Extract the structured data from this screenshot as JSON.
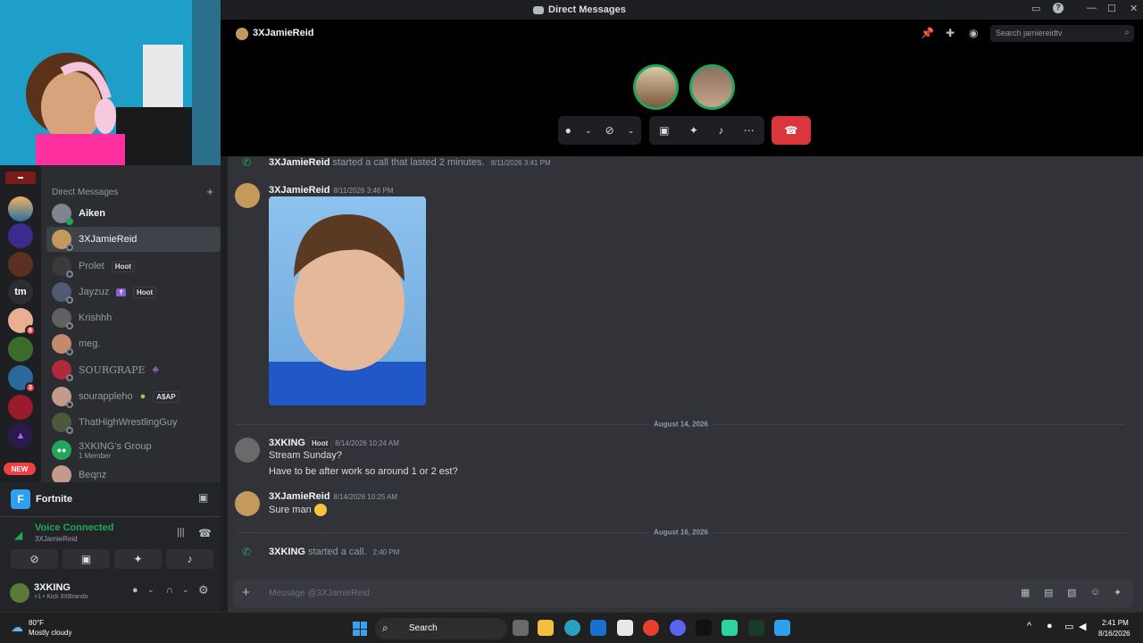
{
  "window": {
    "title": "Direct Messages"
  },
  "header": {
    "username": "3XJamieReid",
    "search_placeholder": "Search jamiereidtv"
  },
  "dm_list": {
    "heading": "Direct Messages",
    "items": [
      {
        "name": "Aiken",
        "tag": ""
      },
      {
        "name": "3XJamieReid",
        "tag": ""
      },
      {
        "name": "Prolet",
        "tag": "Hoot"
      },
      {
        "name": "Jayzuz",
        "tag": "Hoot"
      },
      {
        "name": "Krishhh",
        "tag": ""
      },
      {
        "name": "meg.",
        "tag": ""
      },
      {
        "name": "SOURGRAPE",
        "tag": ""
      },
      {
        "name": "sourappleho",
        "tag": "A$AP"
      },
      {
        "name": "ThatHighWrestlingGuy",
        "tag": ""
      },
      {
        "name": "3XKING's Group",
        "sub": "1 Member"
      },
      {
        "name": "Beqnz",
        "tag": ""
      }
    ]
  },
  "servers": {
    "new_badge": "NEW",
    "tm_label": "tm",
    "badge_1": "8",
    "badge_2": "3"
  },
  "activity": {
    "game": "Fortnite",
    "voice_status": "Voice Connected",
    "voice_channel": "3XJamieReid"
  },
  "user_panel": {
    "name": "3XKING",
    "status": "+1 • Kick 3XBrando"
  },
  "chat": {
    "call1": {
      "name": "3XJamieReid",
      "text": "started a call that lasted 2 minutes.",
      "ts": "8/11/2026 3:41 PM"
    },
    "msg1": {
      "name": "3XJamieReid",
      "ts": "8/11/2026 3:46 PM"
    },
    "date1": "August 14, 2026",
    "msg2": {
      "name": "3XKING",
      "tag": "Hoot",
      "ts": "8/14/2026 10:24 AM",
      "line1": "Stream Sunday?",
      "line2": "Have to be after work so around 1 or 2 est?"
    },
    "msg3": {
      "name": "3XJamieReid",
      "ts": "8/14/2026 10:25 AM",
      "text": "Sure man"
    },
    "date2": "August 16, 2026",
    "call2": {
      "name": "3XKING",
      "text": "started a call.",
      "ts": "2:40 PM"
    }
  },
  "composer": {
    "placeholder": "Message @3XJamieReid"
  },
  "taskbar": {
    "temp": "80°F",
    "weather": "Mostly cloudy",
    "search": "Search",
    "time": "2:41 PM",
    "date": "8/16/2026"
  },
  "colors": {
    "accent_green": "#23a55a",
    "end_call_red": "#da373c",
    "bg_dark": "#1e1f22",
    "chat_bg": "#313338"
  }
}
